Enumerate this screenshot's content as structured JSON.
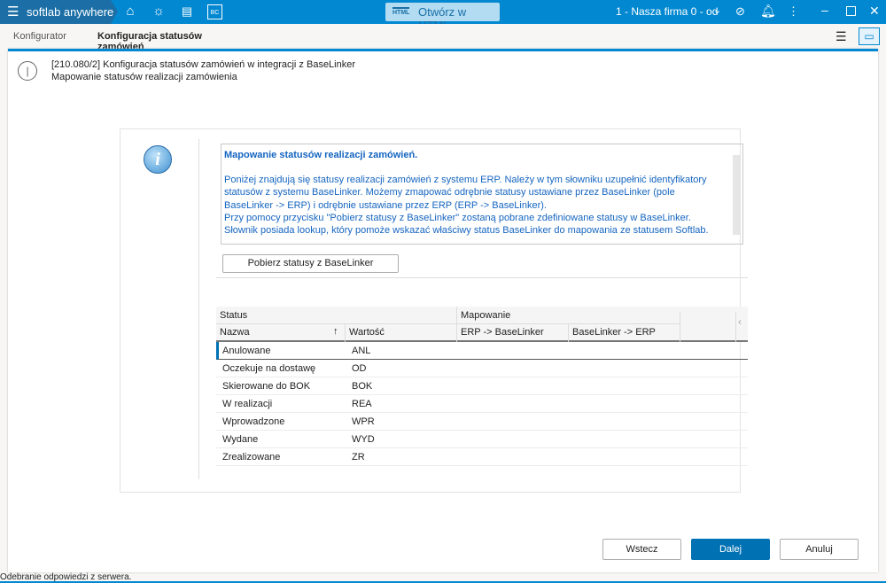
{
  "app": {
    "brand": "softlab anywhere",
    "html_button": "Otwórz w HTML",
    "html_icon_text": "HTML",
    "company": "1 - Nasza firma 0 - od",
    "bc_icon": "BC"
  },
  "tabs": [
    {
      "label": "Konfigurator",
      "active": false
    },
    {
      "label": "Konfiguracja statusów zamówień",
      "active": true
    }
  ],
  "header": {
    "line1": "[210.080/2] Konfiguracja statusów zamówień w integracji z BaseLinker",
    "line2": "Mapowanie statusów realizacji zamówienia"
  },
  "info": {
    "title": "Mapowanie statusów realizacji zamówień.",
    "body": "Poniżej znajdują się statusy realizacji zamówień z systemu ERP. Należy w tym słowniku uzupełnić identyfikatory statusów z systemu BaseLinker. Możemy zmapować odrębnie statusy ustawiane przez BaseLinker (pole BaseLinker -> ERP) i odrębnie ustawiane przez ERP (ERP -> BaseLinker).\nPrzy pomocy przycisku \"Pobierz statusy z BaseLinker\" zostaną pobrane zdefiniowane statusy w BaseLinker. Słownik posiada lookup, który pomoże wskazać właściwy status BaseLinker do mapowania ze statusem Softlab."
  },
  "fetch_button": "Pobierz statusy z BaseLinker",
  "grid": {
    "group_status": "Status",
    "group_mapping": "Mapowanie",
    "col_name": "Nazwa",
    "col_value": "Wartość",
    "col_erp_bl": "ERP -> BaseLinker",
    "col_bl_erp": "BaseLinker -> ERP",
    "rows": [
      {
        "name": "Anulowane",
        "value": "ANL"
      },
      {
        "name": "Oczekuje na dostawę",
        "value": "OD"
      },
      {
        "name": "Skierowane do BOK",
        "value": "BOK"
      },
      {
        "name": "W realizacji",
        "value": "REA"
      },
      {
        "name": "Wprowadzone",
        "value": "WPR"
      },
      {
        "name": "Wydane",
        "value": "WYD"
      },
      {
        "name": "Zrealizowane",
        "value": "ZR"
      }
    ]
  },
  "footer": {
    "back": "Wstecz",
    "next": "Dalej",
    "cancel": "Anuluj"
  },
  "status_bar": "Odebranie odpowiedzi z serwera.",
  "colors": {
    "accent": "#0288d1",
    "primary_button": "#0071b3",
    "info_text": "#1565c0"
  }
}
